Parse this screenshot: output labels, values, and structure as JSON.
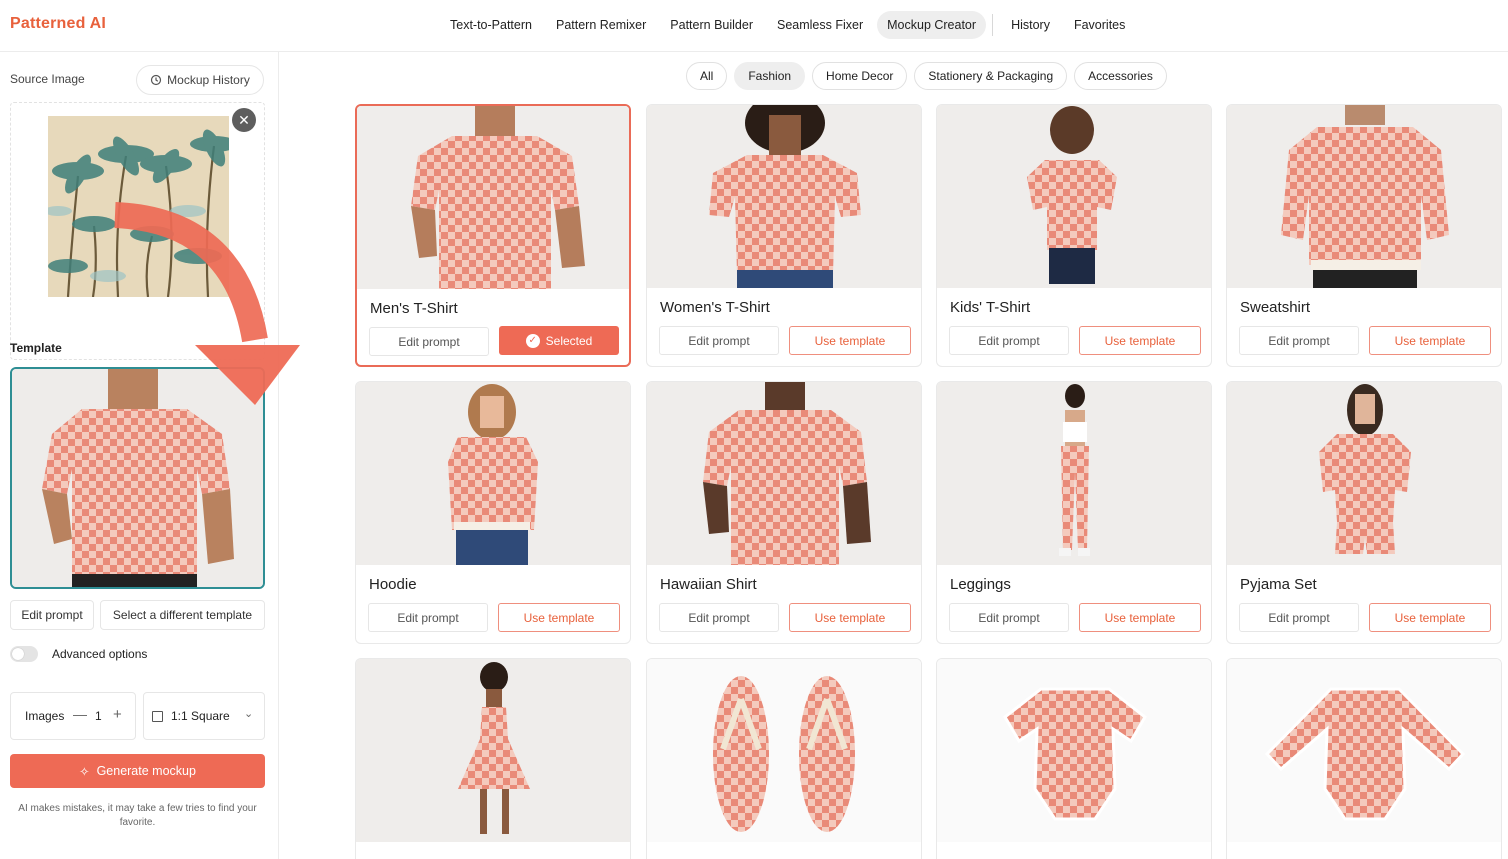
{
  "app": {
    "logo": "Patterned AI"
  },
  "nav": {
    "items": [
      {
        "label": "Text-to-Pattern",
        "active": false
      },
      {
        "label": "Pattern Remixer",
        "active": false
      },
      {
        "label": "Pattern Builder",
        "active": false
      },
      {
        "label": "Seamless Fixer",
        "active": false
      },
      {
        "label": "Mockup Creator",
        "active": true
      },
      {
        "label": "History",
        "active": false
      },
      {
        "label": "Favorites",
        "active": false
      }
    ]
  },
  "sidebar": {
    "source_label": "Source Image",
    "history_button": "Mockup History",
    "template_label": "Template",
    "edit_prompt": "Edit prompt",
    "select_different": "Select a different template",
    "advanced_options": "Advanced options",
    "images_label": "Images",
    "images_count": "1",
    "aspect_ratio": "1:1 Square",
    "generate_button": "Generate mockup",
    "disclaimer": "AI makes mistakes, it may take a few tries to find your favorite."
  },
  "categories": {
    "items": [
      {
        "label": "All",
        "active": false
      },
      {
        "label": "Fashion",
        "active": true
      },
      {
        "label": "Home Decor",
        "active": false
      },
      {
        "label": "Stationery & Packaging",
        "active": false
      },
      {
        "label": "Accessories",
        "active": false
      }
    ]
  },
  "templates": {
    "edit_label": "Edit prompt",
    "use_label": "Use template",
    "selected_label": "Selected",
    "items": [
      {
        "title": "Men's T-Shirt",
        "selected": true
      },
      {
        "title": "Women's T-Shirt",
        "selected": false
      },
      {
        "title": "Kids' T-Shirt",
        "selected": false
      },
      {
        "title": "Sweatshirt",
        "selected": false
      },
      {
        "title": "Hoodie",
        "selected": false
      },
      {
        "title": "Hawaiian Shirt",
        "selected": false
      },
      {
        "title": "Leggings",
        "selected": false
      },
      {
        "title": "Pyjama Set",
        "selected": false
      }
    ]
  },
  "colors": {
    "accent": "#ee6a55",
    "selected_border": "#2e8e94",
    "pattern_light": "#f3c8bb",
    "pattern_dark": "#e98a78"
  }
}
